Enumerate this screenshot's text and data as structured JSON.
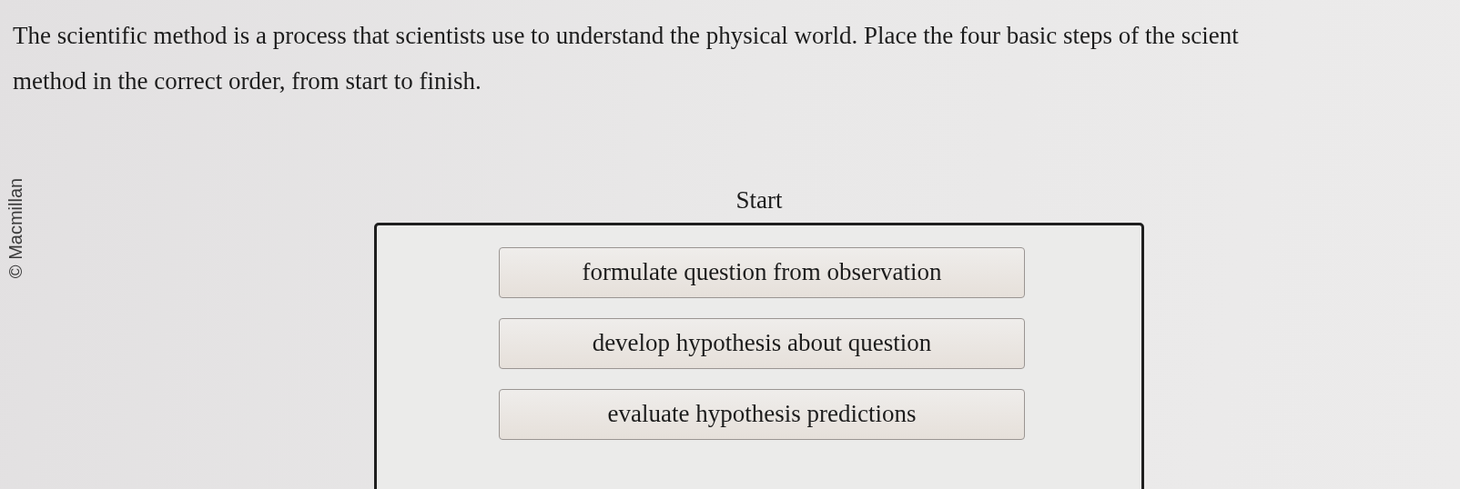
{
  "copyright": "© Macmillan",
  "question_lines": [
    "The scientific method is a process that scientists use to understand the physical world. Place the four basic steps of the scient",
    "method in the correct order, from start to finish."
  ],
  "sequence": {
    "start_label": "Start",
    "items": [
      {
        "label": "formulate question from observation"
      },
      {
        "label": "develop hypothesis about question"
      },
      {
        "label": "evaluate hypothesis predictions"
      }
    ]
  }
}
